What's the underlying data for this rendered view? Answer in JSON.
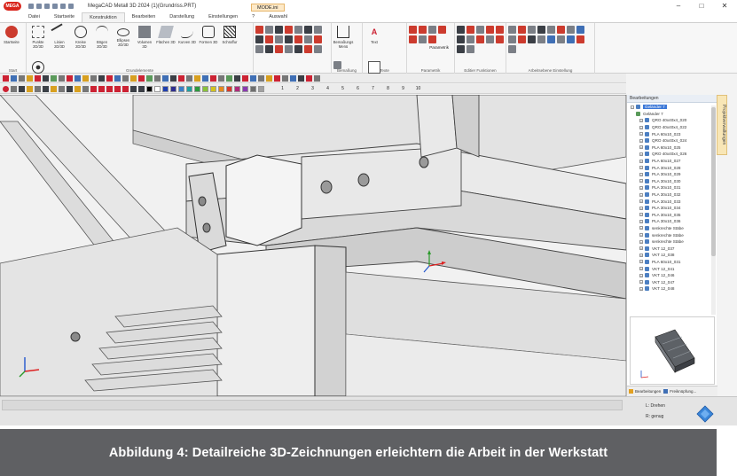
{
  "window": {
    "logo": "MEGA",
    "title": "MegaCAD Metall 3D  2024 (1)(Grundriss.PRT)",
    "mode_badge": "MODE.ini",
    "controls": [
      "–",
      "□",
      "✕"
    ]
  },
  "tabs": [
    {
      "label": "Datei",
      "active": false
    },
    {
      "label": "Startseite",
      "active": false
    },
    {
      "label": "Konstruktion",
      "active": true
    },
    {
      "label": "Bearbeiten",
      "active": false
    },
    {
      "label": "Darstellung",
      "active": false
    },
    {
      "label": "Einstellungen",
      "active": false
    },
    {
      "label": "?",
      "active": false
    },
    {
      "label": "Auswahl",
      "active": false
    }
  ],
  "ribbon": {
    "groups": [
      {
        "label": "Start",
        "buttons": [
          "Startseite"
        ]
      },
      {
        "label": "Grundelemente",
        "buttons": [
          "Punkte 2D/3D",
          "Linien 2D/3D",
          "Kreise 2D/3D",
          "Bögen 2D/3D",
          "Ellipsen 2D/3D",
          "Volumen 3D",
          "Flächen 3D",
          "Kurven 3D",
          "Formen 3D",
          "Schraffur",
          "Bohrung"
        ]
      },
      {
        "label": "",
        "buttons": []
      },
      {
        "label": "Bemaßung",
        "buttons": [
          "Bemaßungs Menü"
        ]
      },
      {
        "label": "Texte",
        "buttons": [
          "Text",
          "RTF Text"
        ]
      },
      {
        "label": "Parametrik",
        "buttons": [
          "Parametrik"
        ]
      },
      {
        "label": "Editier Funktionen",
        "buttons": []
      },
      {
        "label": "Arbeitsebene Einstellung",
        "buttons": []
      }
    ]
  },
  "toolbar": {
    "layers": [
      "1",
      "2",
      "3",
      "4",
      "5",
      "6",
      "7",
      "8",
      "9",
      "10"
    ],
    "palette": [
      "#000000",
      "#ffffff",
      "#1f3fb0",
      "#2f2f8f",
      "#3a7fc9",
      "#20a0a0",
      "#2e9a3e",
      "#89c23a",
      "#d2c21e",
      "#e58a1e",
      "#d83a2a",
      "#b02a7a",
      "#8a3ab0",
      "#6e6e6e",
      "#a0a0a0"
    ]
  },
  "tree": {
    "header": "Bearbeitungen",
    "root": "Geländer 7",
    "child": "Geländer 7",
    "items": [
      "QRO 40x40x4_020",
      "QRO 40x40x4_022",
      "PLA 60x10_023",
      "QRO 40x40x4_024",
      "PLA 60x10_025",
      "QRO 40x40x4_026",
      "PLA 60x10_027",
      "PLA 30x10_028",
      "PLA 30x10_029",
      "PLA 30x10_030",
      "PLA 30x10_031",
      "PLA 30x10_032",
      "PLA 30x10_033",
      "PLA 30x10_034",
      "PLA 30x10_035",
      "PLA 30x10_036",
      "senkrechte Stäbe",
      "senkrechte Stäbe",
      "senkrechte Stäbe",
      "VKT 12_037",
      "VKT 12_038",
      "PLA 60x10_031",
      "VKT 12_041",
      "VKT 12_046",
      "VKT 12_047",
      "VKT 12_048"
    ],
    "panel_tabs": [
      "Bearbeitungen",
      "Freiknüpfung..."
    ],
    "side_tab": "Projektverwaltungen"
  },
  "status": {
    "mouse_left": "L: Drehen",
    "mouse_right": "R: genug"
  },
  "caption": "Abbildung 4: Detailreiche 3D-Zeichnungen erleichtern die Arbeit in der Werkstatt",
  "colors": {
    "caption_bg": "#5f6063",
    "accent_selection": "#3c78d8",
    "mode_badge": "#fde9c8",
    "logo": "#d9251c"
  }
}
